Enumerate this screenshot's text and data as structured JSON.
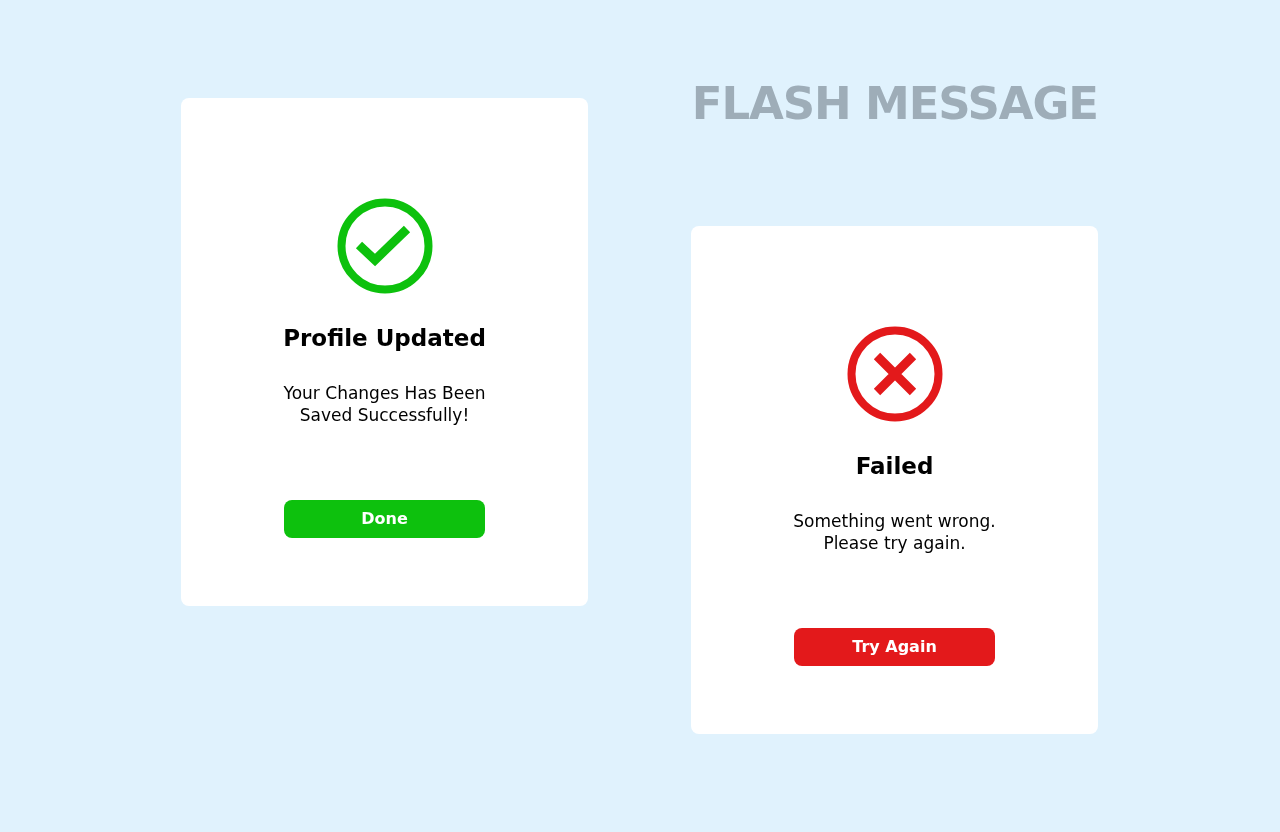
{
  "heading": "FLASH MESSAGE",
  "messages": [
    {
      "kind": "success",
      "title": "Profile Updated",
      "text": "Your Changes Has Been\nSaved Successfully!",
      "button": "Done"
    },
    {
      "kind": "error",
      "title": "Failed",
      "text": "Something went wrong.\nPlease try again.",
      "button": "Try Again"
    }
  ]
}
